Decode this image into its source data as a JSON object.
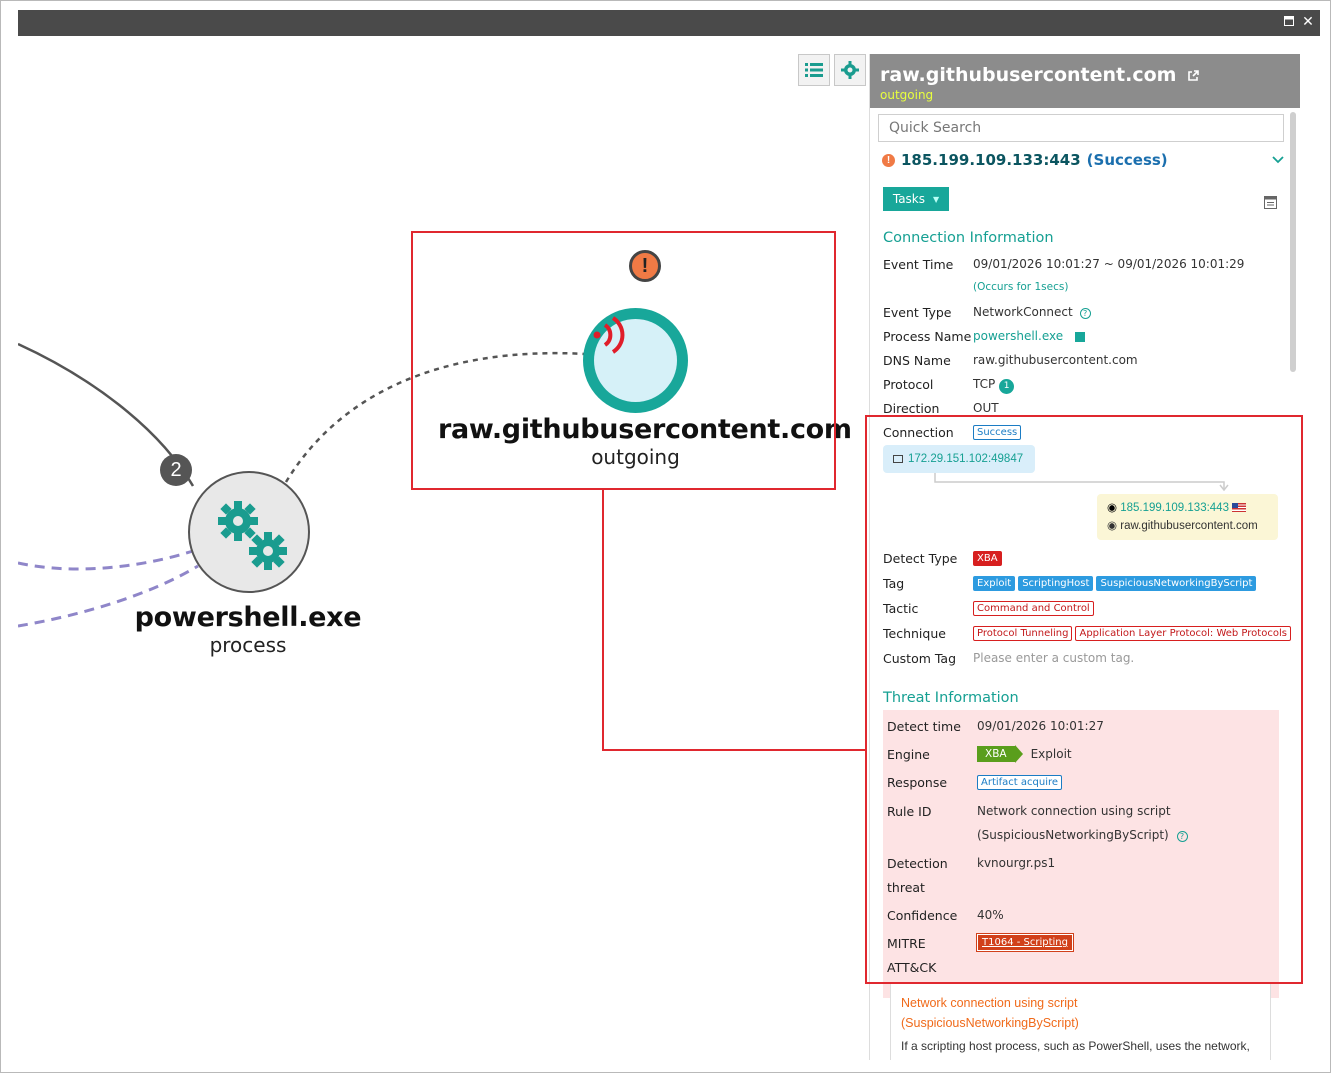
{
  "window": {
    "restore_icon": "restore-icon",
    "close_label": "✕"
  },
  "graph": {
    "process": {
      "name": "powershell.exe",
      "type": "process",
      "badge": "2"
    },
    "destination": {
      "name": "raw.githubusercontent.com",
      "type": "outgoing",
      "alert": "!"
    }
  },
  "panel": {
    "title": "raw.githubusercontent.com",
    "subtitle": "outgoing",
    "search_placeholder": "Quick Search",
    "connection_header": "185.199.109.133:443",
    "connection_status": "(Success)",
    "tasks_label": "Tasks",
    "connection_info": {
      "title": "Connection Information",
      "event_time_label": "Event Time",
      "event_time": "09/01/2026 10:01:27 ~ 09/01/2026 10:01:29",
      "occurs": "(Occurs for 1secs)",
      "event_type_label": "Event Type",
      "event_type": "NetworkConnect",
      "process_name_label": "Process Name",
      "process_name": "powershell.exe",
      "dns_name_label": "DNS Name",
      "dns_name": "raw.githubusercontent.com",
      "protocol_label": "Protocol",
      "protocol": "TCP",
      "protocol_count": "1",
      "direction_label": "Direction",
      "direction": "OUT",
      "connection_label": "Connection",
      "connection_badge": "Success",
      "src": "172.29.151.102:49847",
      "dst_ip": "185.199.109.133:443",
      "dst_host": "raw.githubusercontent.com",
      "detect_type_label": "Detect Type",
      "detect_type": "XBA",
      "tag_label": "Tag",
      "tags": [
        "Exploit",
        "ScriptingHost",
        "SuspiciousNetworkingByScript"
      ],
      "tactic_label": "Tactic",
      "tactic": "Command and Control",
      "technique_label": "Technique",
      "techniques": [
        "Protocol Tunneling",
        "Application Layer Protocol: Web Protocols"
      ],
      "custom_tag_label": "Custom Tag",
      "custom_tag_placeholder": "Please enter a custom tag."
    },
    "threat_info": {
      "title": "Threat Information",
      "detect_time_label": "Detect time",
      "detect_time": "09/01/2026 10:01:27",
      "engine_label": "Engine",
      "engine_badge": "XBA",
      "engine_value": "Exploit",
      "response_label": "Response",
      "response": "Artifact acquire",
      "rule_id_label": "Rule ID",
      "rule_id_line1": "Network connection using script",
      "rule_id_line2": "(SuspiciousNetworkingByScript)",
      "detection_label_1": "Detection",
      "detection_label_2": "threat",
      "detection_threat": "kvnourgr.ps1",
      "confidence_label": "Confidence",
      "confidence": "40%",
      "mitre_label_1": "MITRE",
      "mitre_label_2": "ATT&CK",
      "mitre": "T1064 - Scripting"
    },
    "rule_box": {
      "title_line1": "Network connection using script",
      "title_line2": "(SuspiciousNetworkingByScript)",
      "desc": "If a scripting host process, such as PowerShell, uses the network,"
    }
  },
  "colors": {
    "accent": "#16a093",
    "alert": "#f07a45",
    "highlight": "#e0282f"
  }
}
